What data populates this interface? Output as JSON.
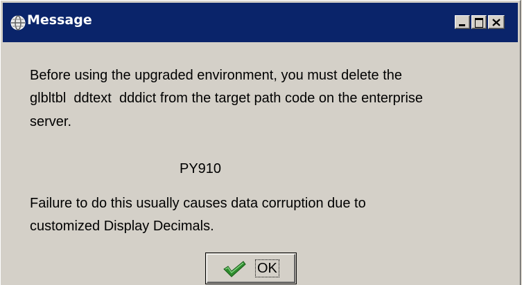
{
  "window": {
    "title": "Message",
    "title_bar_color": "#0a246a",
    "icon": "globe-icon",
    "controls": {
      "minimize": "minimize-icon",
      "maximize": "maximize-icon",
      "close": "close-icon"
    }
  },
  "message": {
    "line1": "Before using the upgraded environment, you must delete the",
    "line2": "glbltbl  ddtext  dddict from the target path code on the enterprise",
    "line3": "server.",
    "path_code": "PY910",
    "line4": "Failure to do this usually causes data corruption due to",
    "line5": "customized Display Decimals."
  },
  "ok_button": {
    "label": "OK",
    "icon": "checkmark-icon",
    "icon_color": "#2e8b2e"
  }
}
